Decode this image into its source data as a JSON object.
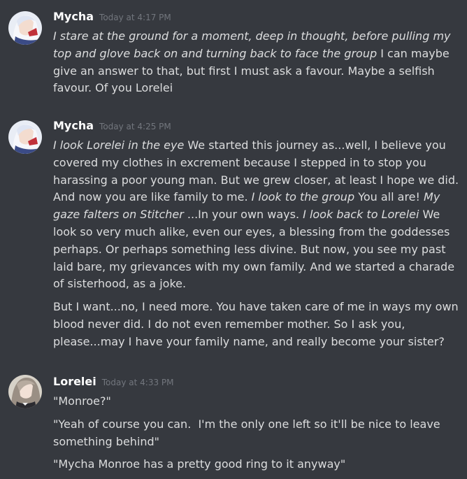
{
  "messages": [
    {
      "username": "Mycha",
      "timestamp": "Today at 4:17 PM",
      "paragraphs": [
        [
          {
            "t": "I stare at the ground for a moment, deep in thought, before pulling my top and glove back on and turning back to face the group",
            "i": true
          },
          {
            "t": " I can maybe give an answer to that, but first I must ask a favour. Maybe a selfish favour. Of you Lorelei",
            "i": false
          }
        ]
      ]
    },
    {
      "username": "Mycha",
      "timestamp": "Today at 4:25 PM",
      "paragraphs": [
        [
          {
            "t": "I look Lorelei in the eye",
            "i": true
          },
          {
            "t": " We started this journey as...well, I believe you covered my clothes in excrement because I stepped in to stop you harassing a poor young man. But we grew closer, at least I hope we did. And now you are like family to me. ",
            "i": false
          },
          {
            "t": "I look to the group",
            "i": true
          },
          {
            "t": " You all are! ",
            "i": false
          },
          {
            "t": "My gaze falters on Stitcher",
            "i": true
          },
          {
            "t": " ...In your own ways. ",
            "i": false
          },
          {
            "t": "I look back to Lorelei",
            "i": true
          },
          {
            "t": " We look so very much alike, even our eyes, a blessing from the goddesses perhaps. Or perhaps something less divine. But now, you see my past laid bare, my grievances with my own family. And we started a charade of sisterhood, as a joke.",
            "i": false
          }
        ],
        [
          {
            "t": "But I want...no, I need more. You have taken care of me in ways my own blood never did. I do not even remember mother. So I ask you, please...may I have your family name, and really become your sister?",
            "i": false
          }
        ]
      ]
    },
    {
      "username": "Lorelei",
      "timestamp": "Today at 4:33 PM",
      "paragraphs": [
        [
          {
            "t": "\"Monroe?\"",
            "i": false
          }
        ],
        [
          {
            "t": "\"Yeah of course you can.  I'm the only one left so it'll be nice to leave something behind\"",
            "i": false
          }
        ],
        [
          {
            "t": "\"Mycha Monroe has a pretty good ring to it anyway\"",
            "i": false
          }
        ]
      ]
    }
  ]
}
